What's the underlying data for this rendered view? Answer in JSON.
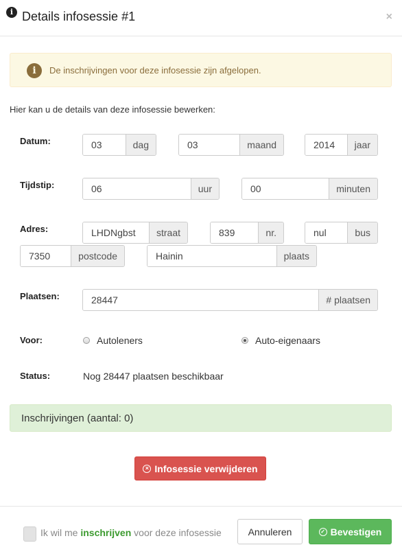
{
  "header": {
    "info_icon": "i",
    "title": "Details infosessie #1",
    "close": "×"
  },
  "alert": {
    "icon": "i",
    "text": "De inschrijvingen voor deze infosessie zijn afgelopen."
  },
  "intro": "Hier kan u de details van deze infosessie bewerken:",
  "datum": {
    "label": "Datum:",
    "dag_value": "03",
    "dag_addon": "dag",
    "maand_value": "03",
    "maand_addon": "maand",
    "jaar_value": "2014",
    "jaar_addon": "jaar"
  },
  "tijdstip": {
    "label": "Tijdstip:",
    "uur_value": "06",
    "uur_addon": "uur",
    "min_value": "00",
    "min_addon": "minuten"
  },
  "adres": {
    "label": "Adres:",
    "straat_value": "LHDNgbst",
    "straat_addon": "straat",
    "nr_value": "839",
    "nr_addon": "nr.",
    "bus_value": "nul",
    "bus_addon": "bus",
    "postcode_value": "7350",
    "postcode_addon": "postcode",
    "plaats_value": "Hainin",
    "plaats_addon": "plaats"
  },
  "plaatsen": {
    "label": "Plaatsen:",
    "value": "28447",
    "addon": "# plaatsen"
  },
  "voor": {
    "label": "Voor:",
    "options": [
      {
        "label": "Autoleners",
        "selected": false
      },
      {
        "label": "Auto-eigenaars",
        "selected": true
      }
    ]
  },
  "status": {
    "label": "Status:",
    "value": "Nog 28447 plaatsen beschikbaar"
  },
  "panel": {
    "title": "Inschrijvingen (aantal: 0)"
  },
  "delete_button": {
    "icon": "×",
    "label": "Infosessie verwijderen"
  },
  "footer": {
    "checkbox_pre": "Ik wil me ",
    "checkbox_emph": "inschrijven",
    "checkbox_post": " voor deze infosessie",
    "cancel_label": "Annuleren",
    "confirm_icon": "✓",
    "confirm_label": "Bevestigen"
  },
  "colors": {
    "alert_bg": "#fcf8e3",
    "alert_text": "#8a6d3b",
    "panel_bg": "#dff0d8",
    "danger": "#d9534f",
    "success": "#5cb85c",
    "emphasis_green": "#3c9a2f"
  }
}
